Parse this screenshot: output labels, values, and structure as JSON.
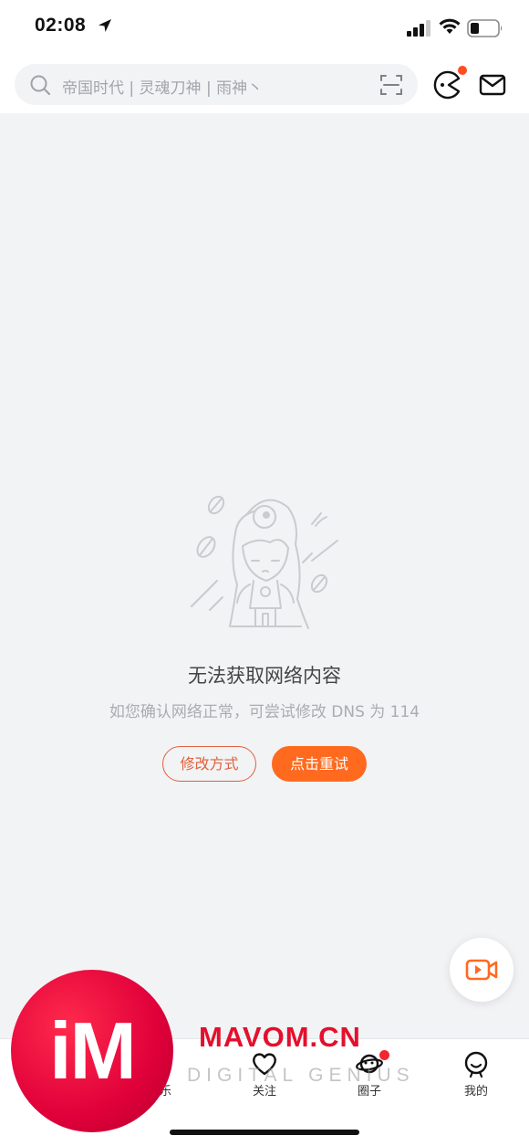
{
  "status_bar": {
    "time": "02:08"
  },
  "search": {
    "placeholder": "帝国时代 | 灵魂刀神 | 雨神丶"
  },
  "empty_state": {
    "title": "无法获取网络内容",
    "hint": "如您确认网络正常，可尝试修改 DNS 为 114",
    "modify_label": "修改方式",
    "retry_label": "点击重试"
  },
  "tab_bar": {
    "items": [
      {
        "label": "乐",
        "icon": "home-icon"
      },
      {
        "label": "关注",
        "icon": "heart-icon"
      },
      {
        "label": "圈子",
        "icon": "planet-icon",
        "badge": true
      },
      {
        "label": "我的",
        "icon": "profile-icon"
      }
    ]
  },
  "watermark": {
    "logo_text": "iM",
    "brand": "MAVOM.CN",
    "tagline": "DIGITAL GENIUS"
  },
  "colors": {
    "accent": "#ff6a1f",
    "outline_button": "#e0603c",
    "badge": "#f2262f",
    "background": "#f2f3f5"
  }
}
